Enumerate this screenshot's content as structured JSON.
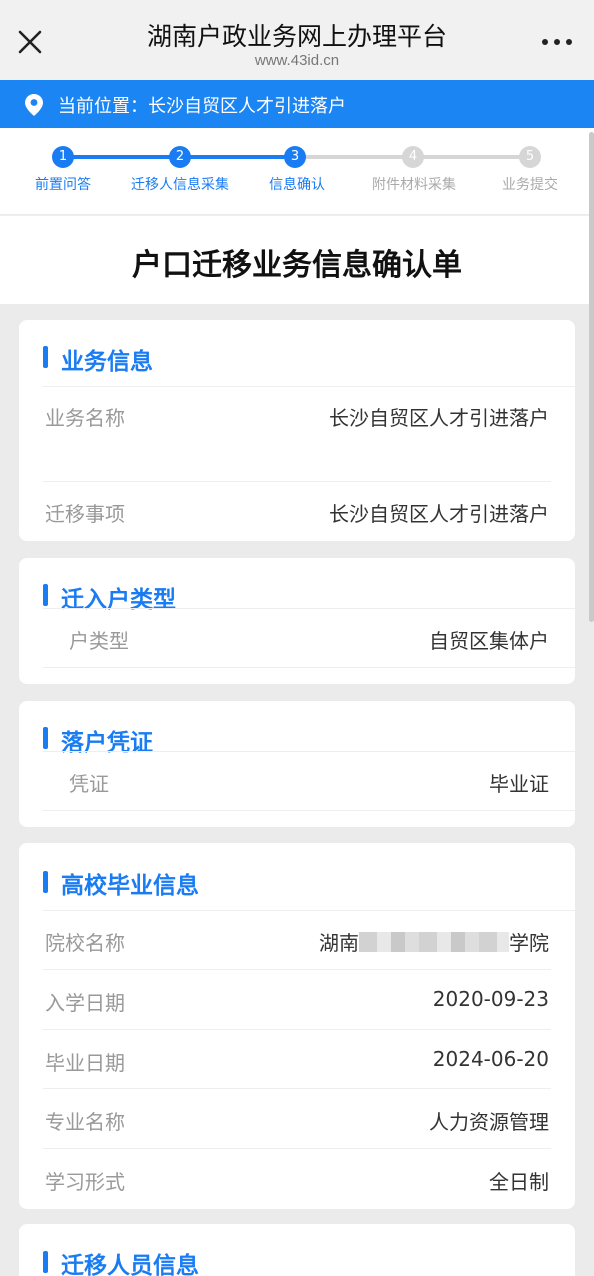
{
  "header": {
    "title": "湖南户政业务网上办理平台",
    "subtitle": "www.43id.cn",
    "close_icon": "close-icon",
    "more_icon": "more-icon"
  },
  "location": {
    "text": "当前位置：长沙自贸区人才引进落户",
    "icon": "location-pin-icon"
  },
  "steps": [
    {
      "num": "1",
      "label": "前置问答",
      "state": "done"
    },
    {
      "num": "2",
      "label": "迁移人信息采集",
      "state": "done"
    },
    {
      "num": "3",
      "label": "信息确认",
      "state": "current"
    },
    {
      "num": "4",
      "label": "附件材料采集",
      "state": "pending"
    },
    {
      "num": "5",
      "label": "业务提交",
      "state": "pending"
    }
  ],
  "document_title": "户口迁移业务信息确认单",
  "sections": {
    "business": {
      "title": "业务信息",
      "rows": [
        {
          "label": "业务名称",
          "value": "长沙自贸区人才引进落户"
        },
        {
          "label": "迁移事项",
          "value": "长沙自贸区人才引进落户"
        }
      ]
    },
    "household_type": {
      "title": "迁入户类型",
      "rows": [
        {
          "label": "户类型",
          "value": "自贸区集体户"
        }
      ]
    },
    "voucher": {
      "title": "落户凭证",
      "rows": [
        {
          "label": "凭证",
          "value": "毕业证"
        }
      ]
    },
    "graduation": {
      "title": "高校毕业信息",
      "rows": [
        {
          "label": "院校名称",
          "value_prefix": "湖南",
          "value_suffix": "学院"
        },
        {
          "label": "入学日期",
          "value": "2020-09-23"
        },
        {
          "label": "毕业日期",
          "value": "2024-06-20"
        },
        {
          "label": "专业名称",
          "value": "人力资源管理"
        },
        {
          "label": "学习形式",
          "value": "全日制"
        }
      ]
    },
    "migrant": {
      "title": "迁移人员信息"
    }
  },
  "colors": {
    "accent": "#1a85f3",
    "title_blue": "#1a7cf3",
    "pending_gray": "#d6d6d6"
  }
}
